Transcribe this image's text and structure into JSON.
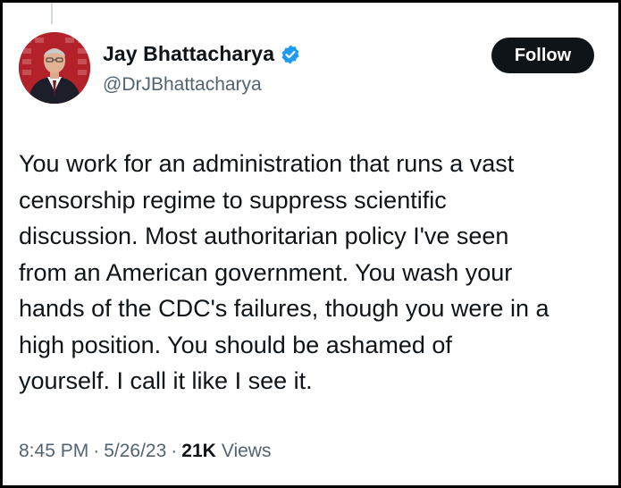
{
  "author": {
    "display_name": "Jay Bhattacharya",
    "handle": "@DrJBhattacharya",
    "verified_icon": "verified-badge-icon",
    "avatar": "avatar-photo"
  },
  "follow_label": "Follow",
  "tweet": {
    "text": "You work for an administration that runs a vast\ncensorship regime to suppress scientific\ndiscussion. Most authoritarian policy I've seen\nfrom an American government. You wash your\nhands of the CDC's failures, though you were in a\nhigh position. You should be ashamed of\nyourself. I call it like I see it."
  },
  "meta": {
    "time": "8:45 PM",
    "separator": "·",
    "date": "5/26/23",
    "views_count": "21K",
    "views_label": "Views"
  },
  "colors": {
    "text_primary": "#0f1419",
    "text_secondary": "#536471",
    "verified_blue": "#1d9bf0",
    "follow_bg": "#0f1419",
    "frame_border": "#000000"
  }
}
